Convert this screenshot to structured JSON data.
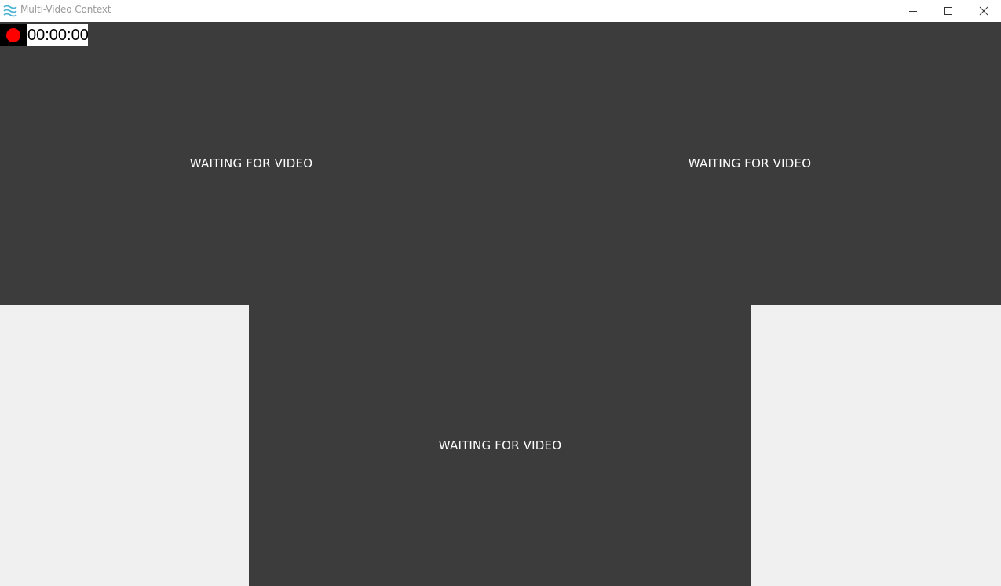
{
  "window": {
    "title": "Multi-Video Context",
    "icon": "waves-icon",
    "controls": {
      "minimize": "minimize-icon",
      "maximize": "maximize-icon",
      "close": "close-icon"
    }
  },
  "recorder": {
    "indicator_color": "#ff0000",
    "time": "00:00:00"
  },
  "panels": [
    {
      "status": "WAITING FOR VIDEO"
    },
    {
      "status": "WAITING FOR VIDEO"
    },
    {
      "status": "WAITING FOR VIDEO"
    }
  ],
  "colors": {
    "panel_bg": "#3c3c3c",
    "app_bg": "#f0f0f0",
    "icon_accent": "#4bb3d3"
  }
}
